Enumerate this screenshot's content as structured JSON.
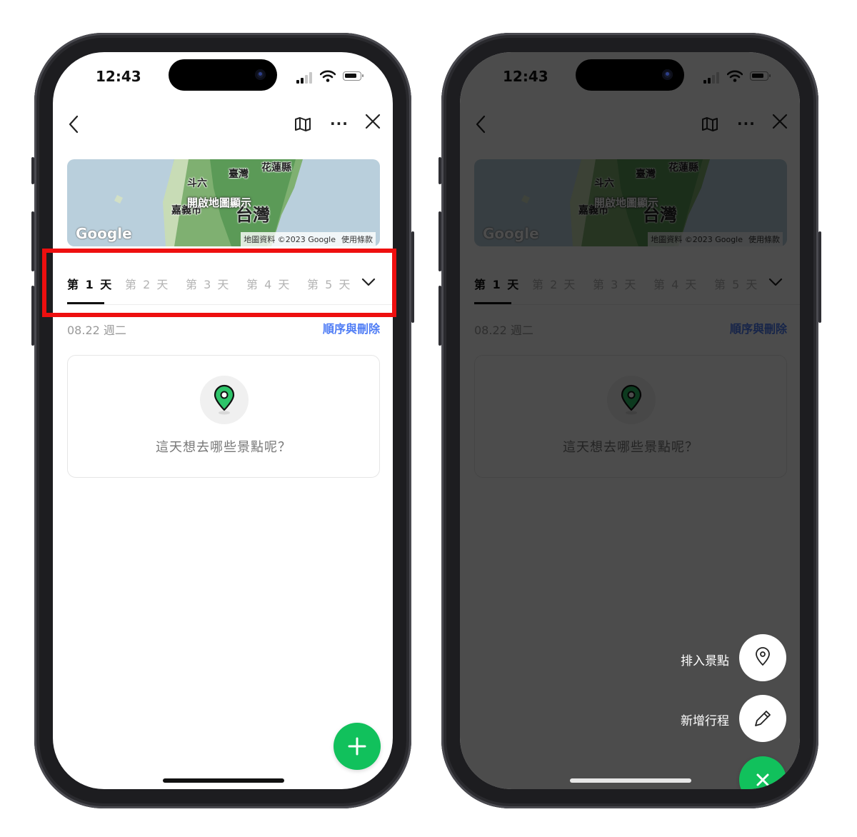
{
  "status": {
    "time": "12:43"
  },
  "map": {
    "labels": [
      "花蓮縣",
      "斗六",
      "臺灣",
      "嘉義市",
      "台灣"
    ],
    "overlay_text": "開啟地圖顯示",
    "logo": "Google",
    "attribution": "地圖資料 ©2023 Google",
    "terms": "使用條款"
  },
  "tabs": [
    {
      "label": "第 1 天",
      "active": true
    },
    {
      "label": "第 2 天",
      "active": false
    },
    {
      "label": "第 3 天",
      "active": false
    },
    {
      "label": "第 4 天",
      "active": false
    },
    {
      "label": "第 5 天",
      "active": false
    }
  ],
  "day": {
    "date": "08.22 週二",
    "order_action": "順序與刪除"
  },
  "empty_state": {
    "prompt": "這天想去哪些景點呢？"
  },
  "fab_menu": {
    "add_spot": "排入景點",
    "add_itinerary": "新增行程"
  },
  "colors": {
    "accent_green": "#11c15c",
    "link_blue": "#4e7cf5",
    "highlight_red": "#ee0f0f"
  },
  "icons": {
    "back": "chevron-left-icon",
    "map": "map-icon",
    "more": "more-icon",
    "close": "close-icon",
    "chevron": "chevron-down-icon",
    "pin": "location-pin-icon",
    "plus": "plus-icon",
    "pencil": "pencil-icon"
  }
}
